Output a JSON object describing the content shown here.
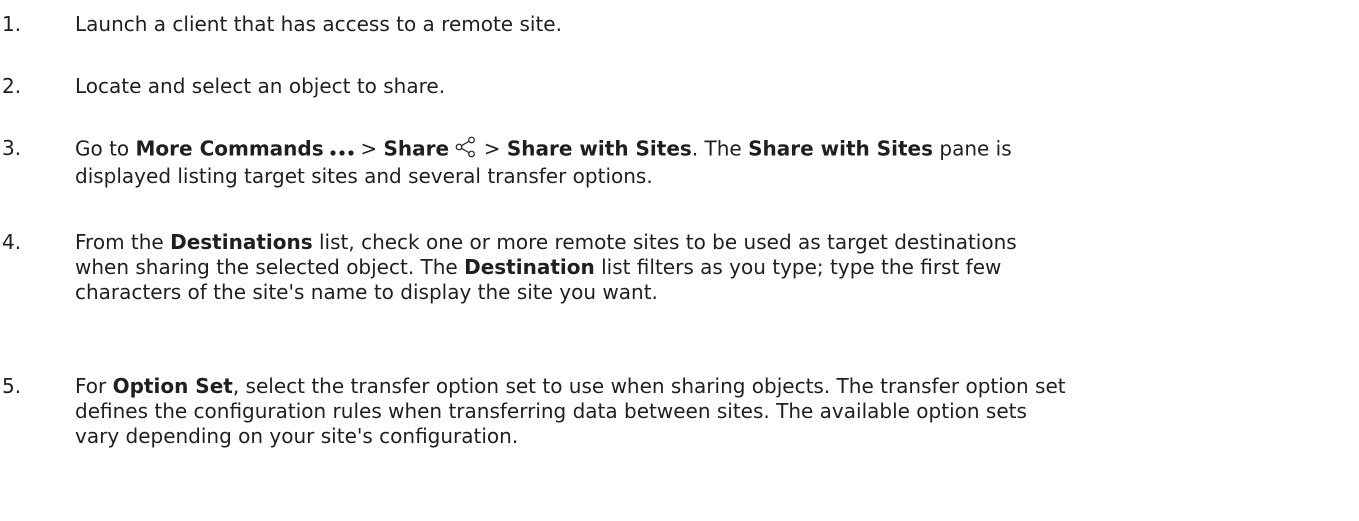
{
  "steps": [
    {
      "number": "1.",
      "text": "Launch a client that has access to a remote site."
    },
    {
      "number": "2.",
      "text": "Locate and select an object to share."
    },
    {
      "number": "3.",
      "go_to": "Go to ",
      "more_commands": "More Commands",
      "more_commands_icon": "more-commands-icon",
      "sep1": " > ",
      "share": "Share",
      "share_icon": "share-icon",
      "sep2": " > ",
      "share_with_sites": "Share with Sites",
      "after": ". The ",
      "share_with_sites_pane": "Share with Sites",
      "tail": " pane is displayed listing target sites and several transfer options."
    },
    {
      "number": "4.",
      "from": "From the ",
      "destinations": "Destinations",
      "middle": " list, check one or more remote sites to be used as target destinations when sharing the selected object. The ",
      "destination": "Destination",
      "tail": " list filters as you type; type the first few characters of the site's name to display the site you want."
    },
    {
      "number": "5.",
      "for": "For ",
      "option_set": "Option Set",
      "tail": ", select the transfer option set to use when sharing objects. The transfer option set defines the configuration rules when transferring data between sites. The available option sets vary depending on your site's configuration."
    }
  ]
}
